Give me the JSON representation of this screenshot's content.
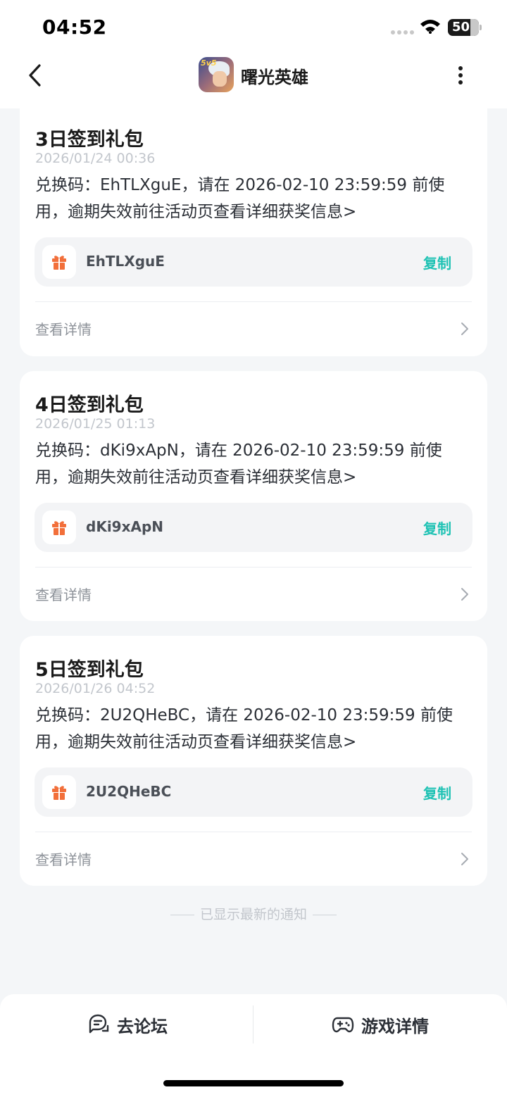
{
  "status_bar": {
    "time": "04:52",
    "battery": "50"
  },
  "nav": {
    "title": "曙光英雄",
    "app_icon_badge": "5v5"
  },
  "colors": {
    "accent": "#1fc2b4",
    "gift": "#f26f3a",
    "background": "#f4f6f8"
  },
  "cards": [
    {
      "title": "3日签到礼包",
      "date": "2026/01/24 00:36",
      "body": "兑换码：EhTLXguE，请在 2026-02-10 23:59:59 前使用，逾期失效前往活动页查看详细获奖信息>",
      "code": "EhTLXguE",
      "copy_label": "复制",
      "detail_label": "查看详情"
    },
    {
      "title": "4日签到礼包",
      "date": "2026/01/25 01:13",
      "body": "兑换码：dKi9xApN，请在 2026-02-10 23:59:59 前使用，逾期失效前往活动页查看详细获奖信息>",
      "code": "dKi9xApN",
      "copy_label": "复制",
      "detail_label": "查看详情"
    },
    {
      "title": "5日签到礼包",
      "date": "2026/01/26 04:52",
      "body": "兑换码：2U2QHeBC，请在 2026-02-10 23:59:59 前使用，逾期失效前往活动页查看详细获奖信息>",
      "code": "2U2QHeBC",
      "copy_label": "复制",
      "detail_label": "查看详情"
    }
  ],
  "end_note": "已显示最新的通知",
  "bottom_bar": {
    "forum_label": "去论坛",
    "game_detail_label": "游戏详情"
  }
}
